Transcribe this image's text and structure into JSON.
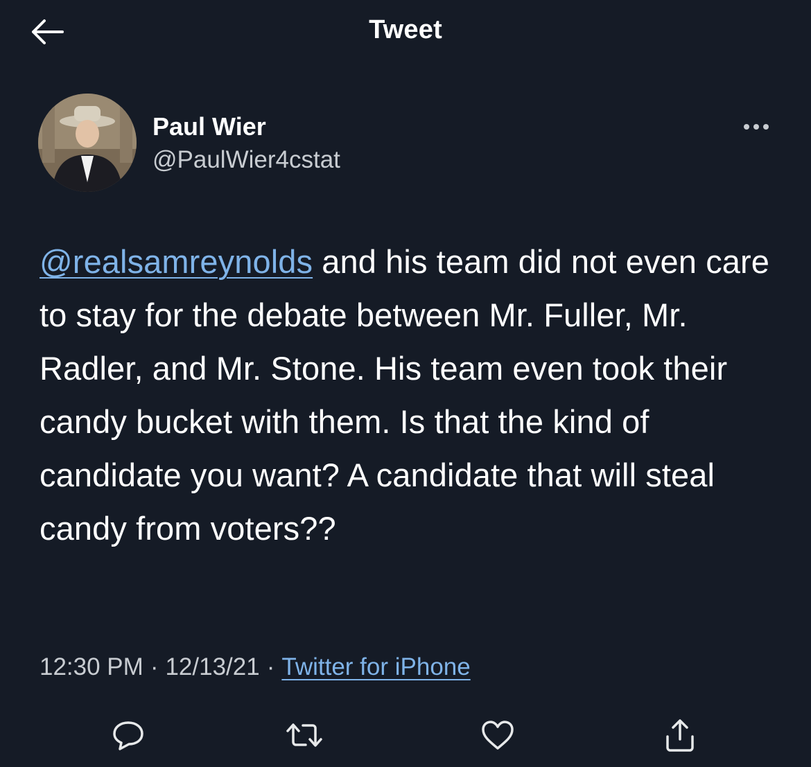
{
  "header": {
    "title": "Tweet",
    "back_icon": "arrow-left-icon"
  },
  "author": {
    "name": "Paul Wier",
    "handle": "@PaulWier4cstat",
    "more_icon": "more-horizontal-icon"
  },
  "tweet": {
    "mention": "@realsamreynolds",
    "body": " and his team did not even care to stay for the debate between Mr. Fuller, Mr. Radler, and Mr. Stone. His team even took their candy bucket with them. Is that the kind of candidate you want? A candidate that will steal candy from voters??"
  },
  "meta": {
    "time": "12:30 PM",
    "separator": "·",
    "date": "12/13/21",
    "source": "Twitter for iPhone"
  },
  "actions": [
    {
      "name": "reply",
      "icon": "reply-icon"
    },
    {
      "name": "retweet",
      "icon": "retweet-icon"
    },
    {
      "name": "like",
      "icon": "heart-icon"
    },
    {
      "name": "share",
      "icon": "share-icon"
    }
  ],
  "colors": {
    "background": "#151b26",
    "text": "#ffffff",
    "secondary_text": "#c8ccd1",
    "link": "#7fb3e8"
  }
}
